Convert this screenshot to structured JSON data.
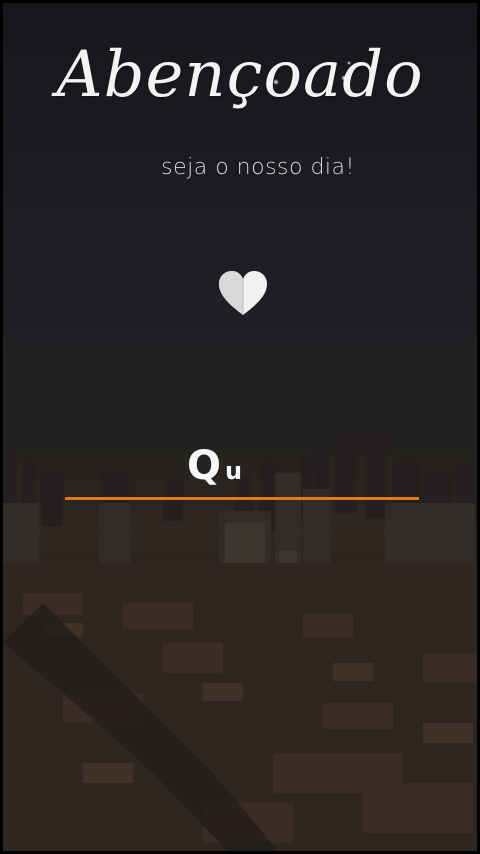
{
  "greeting": {
    "title": "Abençoado",
    "subtitle": "seja o nosso dia!"
  },
  "input": {
    "typed_main": "Q",
    "typed_tail": "u"
  },
  "colors": {
    "text": "#f3f3f3",
    "underline": "#e27a1a",
    "sky_top": "#1b1d22",
    "city": "#3a3029"
  },
  "icons": {
    "heart": "white-folded-heart"
  }
}
